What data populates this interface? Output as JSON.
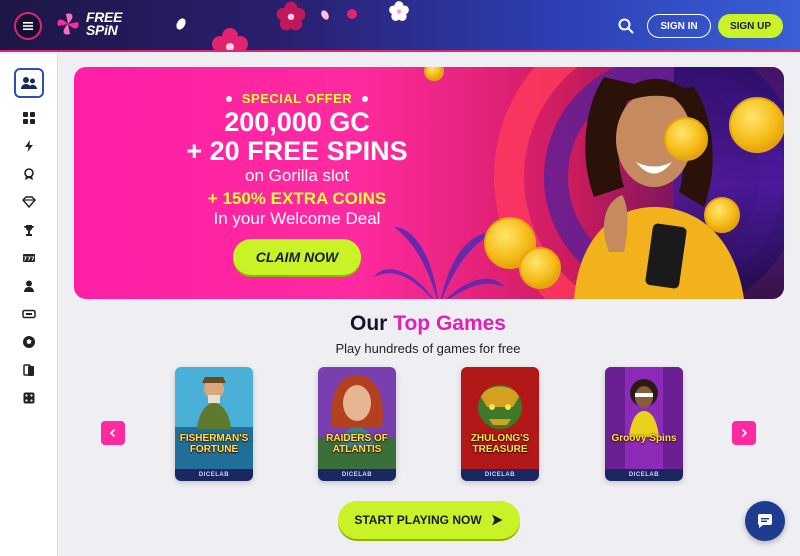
{
  "header": {
    "logo_line1": "FREE",
    "logo_line2": "SPiN",
    "sign_in": "SIGN IN",
    "sign_up": "SIGN UP"
  },
  "banner": {
    "special": "SPECIAL OFFER",
    "line1": "200,000 GC",
    "line2": "+ 20 FREE SPINS",
    "line3": "on Gorilla slot",
    "line4": "+ 150% EXTRA COINS",
    "line5": "In your Welcome Deal",
    "claim": "CLAIM NOW"
  },
  "games_section": {
    "title_prefix": "Our",
    "title_accent": "Top Games",
    "subtitle": "Play hundreds of games for free",
    "games": [
      {
        "title": "FISHERMAN'S FORTUNE",
        "brand": "DICELAB"
      },
      {
        "title": "RAIDERS OF ATLANTIS",
        "brand": "DICELAB"
      },
      {
        "title": "ZHULONG'S TREASURE",
        "brand": "DICELAB"
      },
      {
        "title": "Groovy Spins",
        "brand": "DICELAB"
      }
    ],
    "cta": "START PLAYING NOW"
  },
  "colors": {
    "accent_pink": "#ff2a9f",
    "accent_lime": "#c9f227",
    "header_navy": "#1c1746"
  },
  "icons": [
    "menu-icon",
    "search-icon",
    "chat-icon",
    "users-icon",
    "grid-icon",
    "bolt-icon",
    "badge-icon",
    "diamond-icon",
    "trophy-icon",
    "slot-777-icon",
    "person-icon",
    "ticket-icon",
    "soccer-icon",
    "cards-icon",
    "dice-icon"
  ]
}
